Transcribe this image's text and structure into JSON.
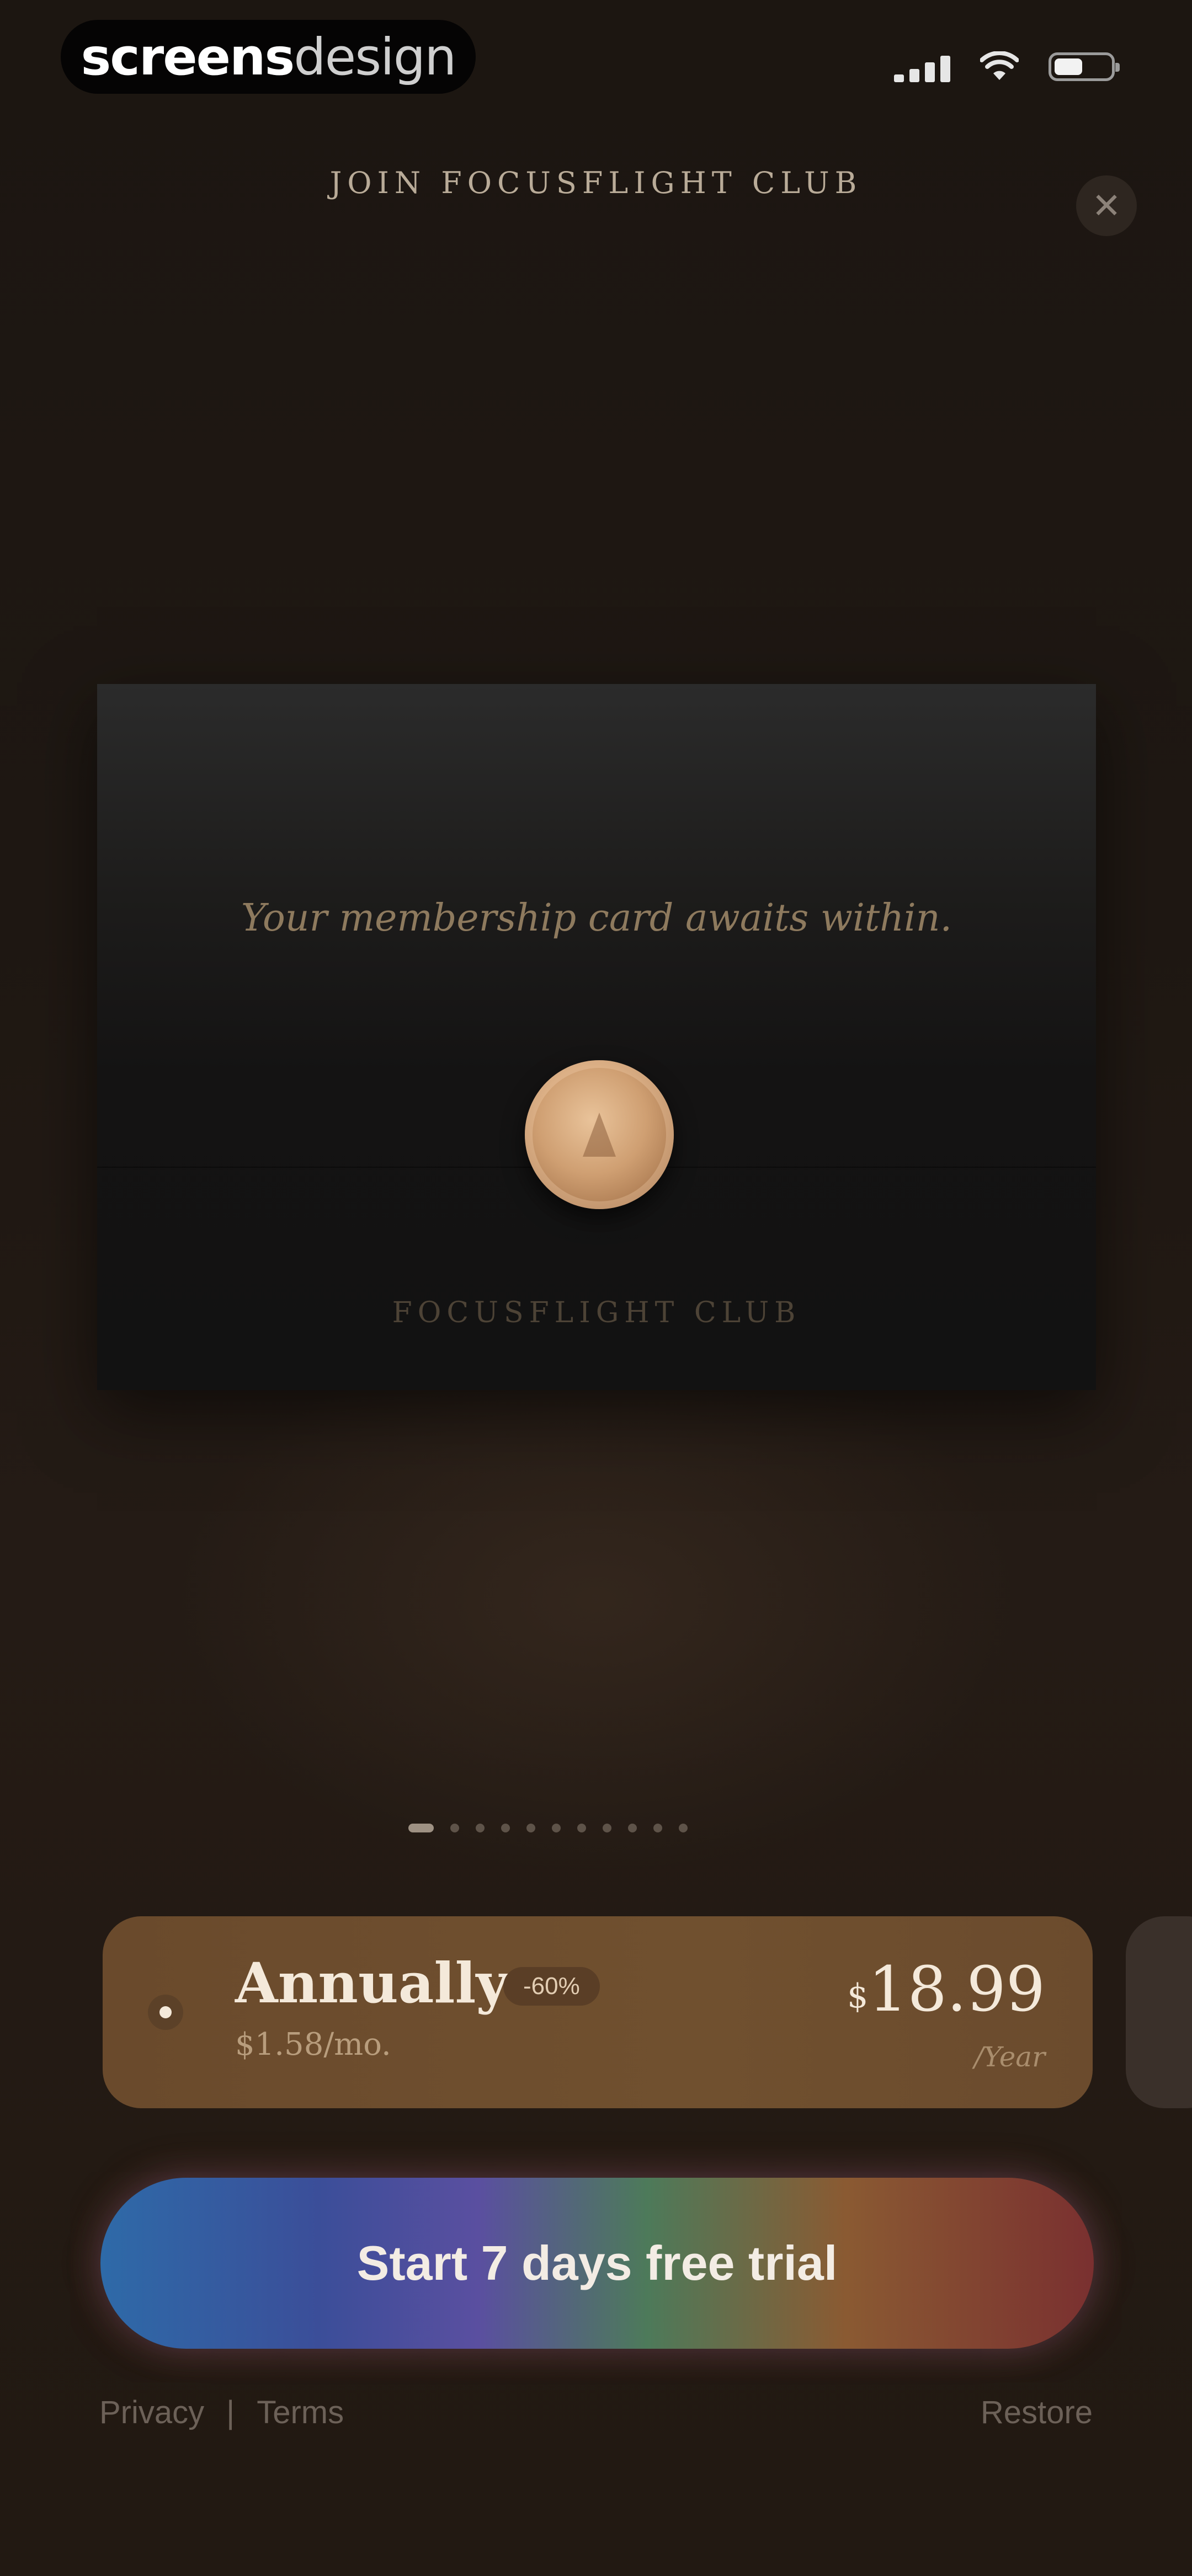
{
  "status_bar": {
    "brand_bold": "screens",
    "brand_light": "design"
  },
  "header": {
    "title": "JOIN FOCUSFLIGHT CLUB",
    "close_symbol": "✕",
    "close_icon": "close-icon"
  },
  "card": {
    "caption": "Your membership card awaits within.",
    "brand": "FOCUSFLIGHT CLUB",
    "seal_icon": "wax-seal-icon"
  },
  "pager": {
    "total_pages": 11,
    "active_index": 0
  },
  "plan": {
    "name": "Annually",
    "discount": "-60%",
    "monthly_price": "$1.58/mo.",
    "currency": "$",
    "price": "18.99",
    "period": "/Year"
  },
  "cta": {
    "label": "Start 7 days free trial"
  },
  "footer": {
    "privacy": "Privacy",
    "separator": "|",
    "terms": "Terms",
    "restore": "Restore"
  },
  "colors": {
    "background": "#231a14",
    "plan_card": "#6a4a2c",
    "seal": "#cf9f72",
    "cta_blue": "#2e6aa8",
    "cta_orange": "#8a5a32"
  }
}
